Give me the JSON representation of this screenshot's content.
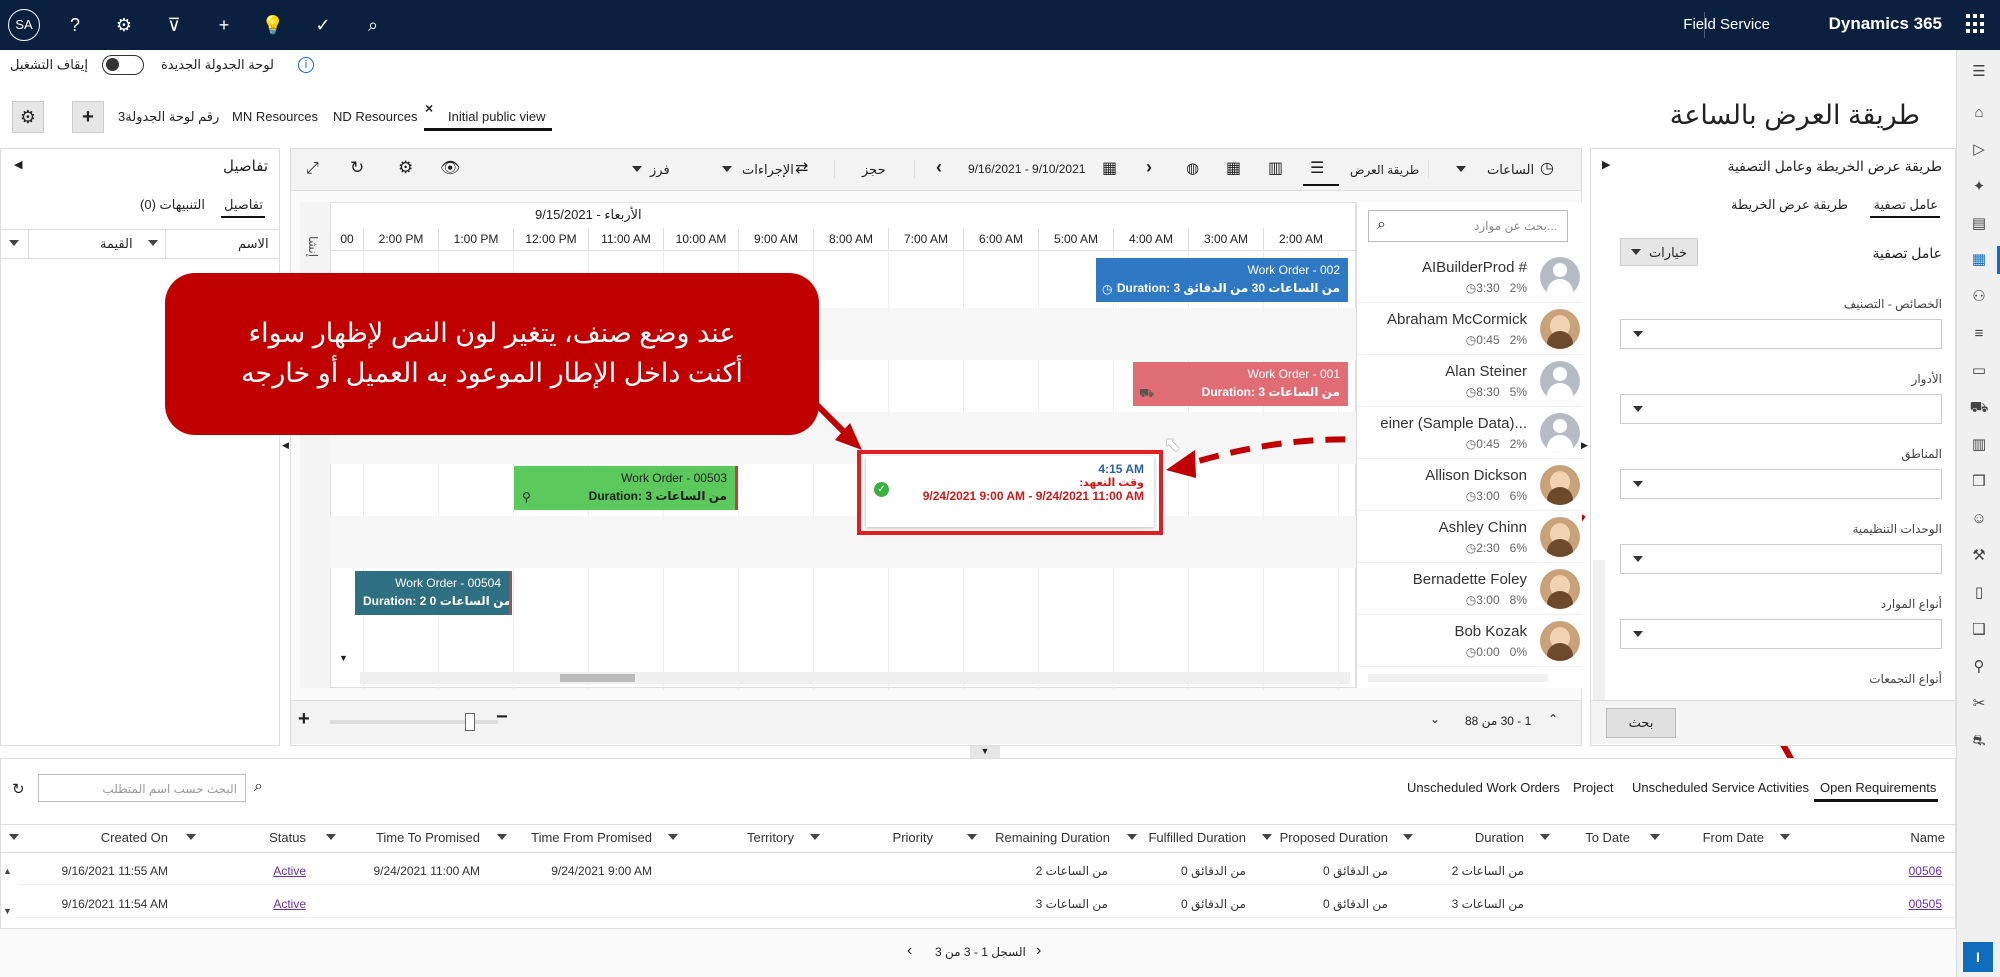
{
  "topbar": {
    "avatar": "SA",
    "app_name": "Field Service",
    "product_name": "Dynamics 365"
  },
  "toggle_row": {
    "new_board_label": "لوحة الجدولة الجديدة",
    "off_label": "إيقاف التشغيل"
  },
  "tabs": {
    "items": [
      "Initial public view",
      "ND Resources",
      "MN Resources",
      "رقم لوحة الجدولة3"
    ],
    "page_title": "طريقة العرض بالساعة"
  },
  "left_panel": {
    "title": "تفاصيل",
    "tab_details": "تفاصيل",
    "tab_alerts": "التنبيهات (0)",
    "col_name": "الاسم",
    "col_value": "القيمة"
  },
  "toolbar": {
    "hours": "الساعات",
    "view_mode": "طريقة العرض",
    "date_range": "9/16/2021 - 9/10/2021",
    "book": "حجز",
    "actions": "الإجراءات",
    "sort": "فرز"
  },
  "schedule": {
    "date_header": "9/15/2021 - الأربعاء",
    "hours": [
      "2:00 AM",
      "3:00 AM",
      "4:00 AM",
      "5:00 AM",
      "6:00 AM",
      "7:00 AM",
      "8:00 AM",
      "9:00 AM",
      "10:00 AM",
      "11:00 AM",
      "12:00 PM",
      "1:00 PM",
      "2:00 PM",
      "00"
    ],
    "side_label": "إنشا",
    "search_placeholder": "بحث عن موارد...",
    "pager": "1 - 30 من 88"
  },
  "bookings": [
    {
      "title": "Work Order - 002",
      "duration": "Duration: 3 من الساعات 30 من الدقائق",
      "color": "#2f78c4"
    },
    {
      "title": "Work Order - 001",
      "duration": "Duration: 3 من الساعات",
      "color": "#e06c75"
    },
    {
      "title": "Work Order - 00503",
      "duration": "Duration: 3 من الساعات",
      "color": "#5cc95c"
    },
    {
      "title": "Work Order - 00504",
      "duration": "Duration: 2 من الساعات 0",
      "color": "#2e6f82"
    }
  ],
  "tooltip": {
    "time": "4:15 AM",
    "promise_label": "وقت التعهد:",
    "promise_window": "9/24/2021 9:00 AM - 9/24/2021 11:00 AM"
  },
  "callout": {
    "line1": "عند وضع صنف، يتغير لون النص لإظهار سواء",
    "line2": "أكنت داخل الإطار الموعود به العميل أو خارجه"
  },
  "resources": [
    {
      "name": "AIBuilderProd #",
      "pct": "2%",
      "time": "3:30"
    },
    {
      "name": "Abraham McCormick",
      "pct": "2%",
      "time": "0:45"
    },
    {
      "name": "Alan Steiner",
      "pct": "5%",
      "time": "8:30"
    },
    {
      "name": "einer (Sample Data)...",
      "pct": "2%",
      "time": "0:45"
    },
    {
      "name": "Allison Dickson",
      "pct": "6%",
      "time": "3:00"
    },
    {
      "name": "Ashley Chinn",
      "pct": "6%",
      "time": "2:30"
    },
    {
      "name": "Bernadette Foley",
      "pct": "8%",
      "time": "3:00"
    },
    {
      "name": "Bob Kozak",
      "pct": "0%",
      "time": "0:00"
    }
  ],
  "filter_panel": {
    "title": "طريقة عرض الخريطة وعامل التصفية",
    "tab_filter": "عامل تصفية",
    "tab_map": "طريقة عرض الخريطة",
    "filter_heading": "عامل تصفية",
    "options_btn": "خيارات",
    "fields": [
      "الخصائص - التصنيف",
      "الأدوار",
      "المناطق",
      "الوحدات التنظيمية",
      "أنواع الموارد",
      "أنواع التجمعات"
    ],
    "search_btn": "بحث"
  },
  "requirements": {
    "tabs": [
      "Open Requirements",
      "Unscheduled Service Activities",
      "Project",
      "Unscheduled Work Orders"
    ],
    "search_placeholder": "البحث حسب اسم المتطلب",
    "columns": [
      "Name",
      "From Date",
      "To Date",
      "Duration",
      "Proposed Duration",
      "Fulfilled Duration",
      "Remaining Duration",
      "Priority",
      "Territory",
      "Time From Promised",
      "Time To Promised",
      "Status",
      "Created On"
    ],
    "rows": [
      {
        "name": "00506",
        "duration": "2 من الساعات",
        "proposed": "0 من الدقائق",
        "fulfilled": "0 من الدقائق",
        "remaining": "2 من الساعات",
        "from_promised": "9/24/2021 9:00 AM",
        "to_promised": "9/24/2021 11:00 AM",
        "status": "Active",
        "created": "9/16/2021 11:55 AM"
      },
      {
        "name": "00505",
        "duration": "3 من الساعات",
        "proposed": "0 من الدقائق",
        "fulfilled": "0 من الدقائق",
        "remaining": "3 من الساعات",
        "from_promised": "",
        "to_promised": "",
        "status": "Active",
        "created": "9/16/2021 11:54 AM"
      }
    ],
    "pager": "السجل 1 - 3 من 3"
  },
  "colors": {
    "topbar": "#0b1f3f",
    "accent": "#0f6cbd",
    "callout": "#c00000",
    "highlight_border": "#e02020"
  }
}
